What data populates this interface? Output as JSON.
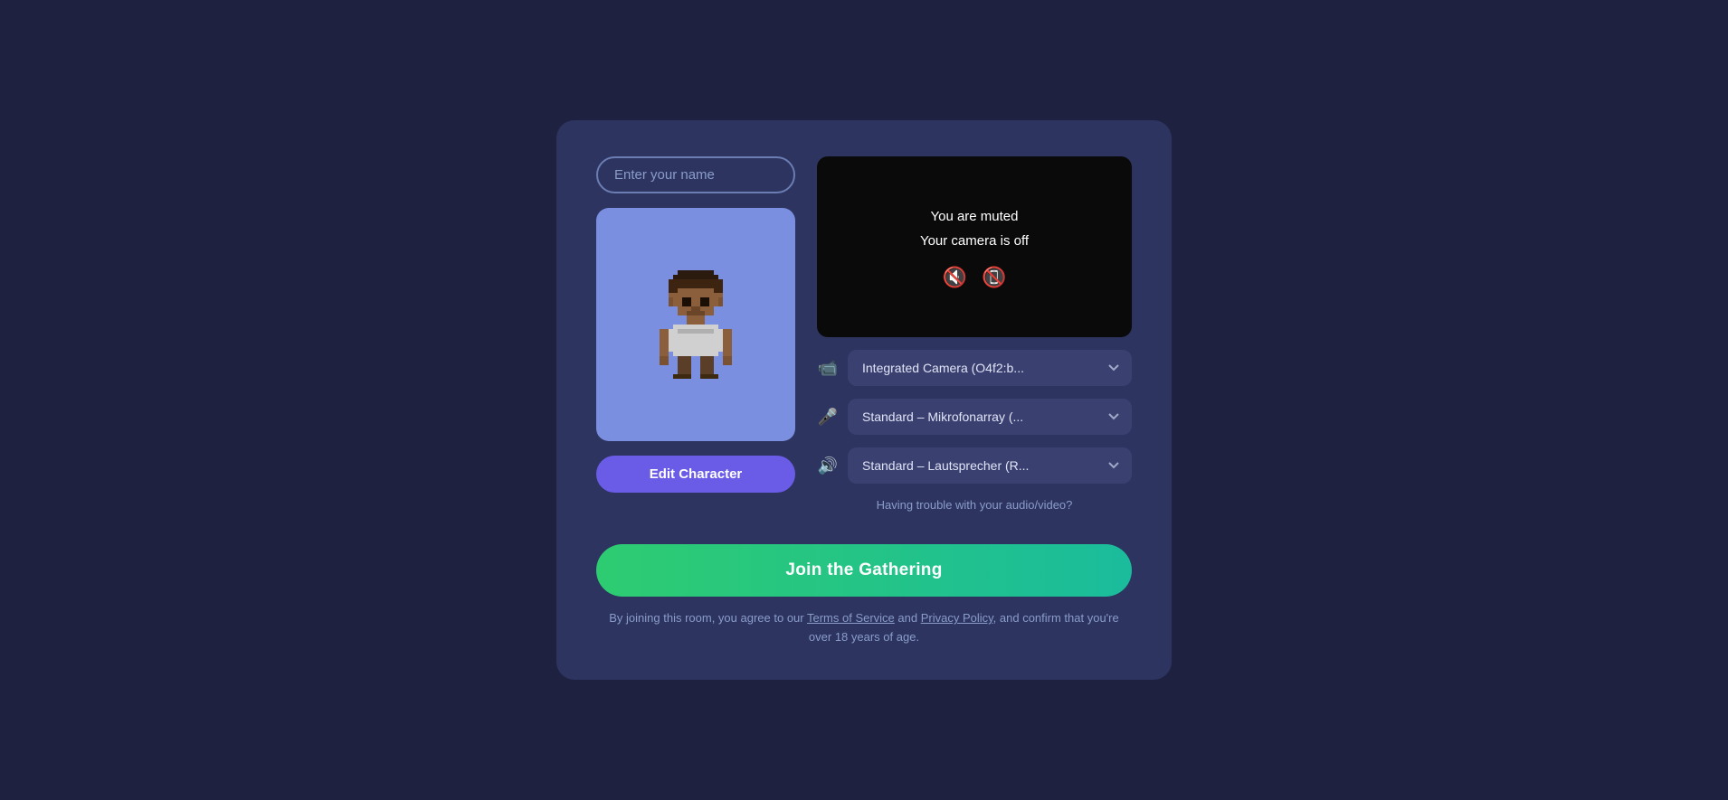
{
  "modal": {
    "name_input_placeholder": "Enter your name",
    "camera_muted_line1": "You are muted",
    "camera_muted_line2": "Your camera is off",
    "edit_character_label": "Edit Character",
    "join_button_label": "Join the Gathering",
    "trouble_text": "Having trouble with your audio/video?",
    "terms_text_1": "By joining this room, you agree to our ",
    "terms_link1": "Terms of Service",
    "terms_text_2": " and ",
    "terms_link2": "Privacy Policy",
    "terms_text_3": ", and confirm that you're over 18 years of age.",
    "devices": {
      "camera_icon": "📹",
      "mic_icon": "🎤",
      "speaker_icon": "🔊",
      "camera_options": [
        "Integrated Camera (O4f2:b..."
      ],
      "mic_options": [
        "Standard – Mikrofonarray (..."
      ],
      "speaker_options": [
        "Standard – Lautsprecher (R..."
      ]
    },
    "colors": {
      "accent_purple": "#6b5ce7",
      "accent_green": "#2ecc71",
      "muted_red": "#e53935",
      "bg_dark": "#1e2240",
      "bg_modal": "#2d3460"
    }
  }
}
